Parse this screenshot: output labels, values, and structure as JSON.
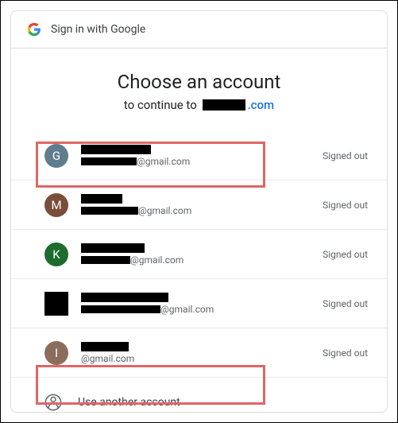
{
  "header": {
    "title": "Sign in with Google"
  },
  "main": {
    "title": "Choose an account",
    "continue_prefix": "to continue to",
    "continue_suffix": ".com"
  },
  "accounts": [
    {
      "initial": "G",
      "avatar_color": "#5f7d8c",
      "email_suffix": "@gmail.com",
      "status": "Signed out",
      "name_w": 88,
      "email_w": 70
    },
    {
      "initial": "M",
      "avatar_color": "#7a4f3a",
      "email_suffix": "@gmail.com",
      "status": "Signed out",
      "name_w": 52,
      "email_w": 72
    },
    {
      "initial": "K",
      "avatar_color": "#1e6b2e",
      "email_suffix": "@gmail.com",
      "status": "Signed out",
      "name_w": 80,
      "email_w": 62
    },
    {
      "initial": "",
      "avatar_color": "#000000",
      "email_suffix": "@gmail.com",
      "status": "Signed out",
      "name_w": 110,
      "email_w": 100,
      "square": true
    },
    {
      "initial": "I",
      "avatar_color": "#8a6d5a",
      "email_suffix": "@gmail.com",
      "status": "Signed out",
      "name_w": 60,
      "email_w": 0
    }
  ],
  "use_another": {
    "label": "Use another account"
  }
}
